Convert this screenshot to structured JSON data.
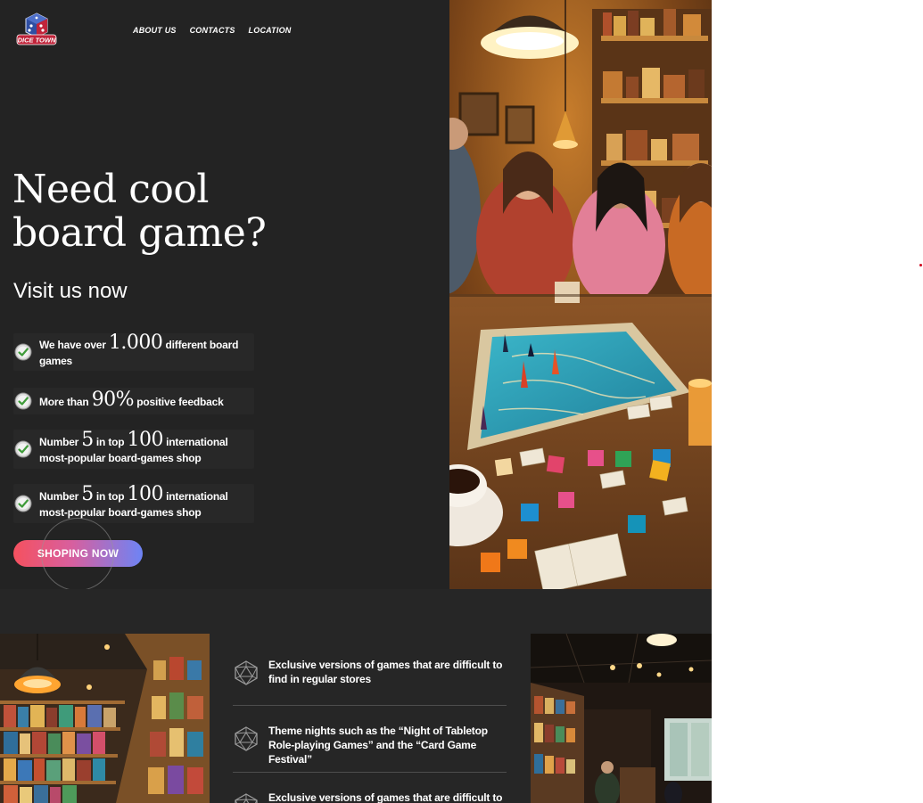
{
  "header": {
    "logo_text": "DICE TOWN",
    "nav": [
      "ABOUT US",
      "CONTACTS",
      "LOCATION"
    ]
  },
  "hero": {
    "title_line1": "Need cool",
    "title_line2": "board game?",
    "subtitle": "Visit us now",
    "features": [
      {
        "pre": "We have over",
        "num": "1.000",
        "post": "different board games"
      },
      {
        "pre": "More than",
        "num": "90%",
        "post": "positive feedback"
      },
      {
        "pre": "Number",
        "num": "5",
        "mid": "in top",
        "num2": "100",
        "post": "international most-popular board-games shop"
      },
      {
        "pre": "Number",
        "num": "5",
        "mid": "in top",
        "num2": "100",
        "post": "international most-popular board-games shop"
      }
    ],
    "cta_label": "SHOPING NOW",
    "check_icon": "checkmark-badge-icon"
  },
  "services": [
    {
      "text": "Exclusive versions of games that are difficult to find in regular stores"
    },
    {
      "text": "Theme nights such as the “Night of Tabletop Role-playing Games” and the “Card Game Festival”"
    },
    {
      "text": "Exclusive versions of games that are difficult to"
    }
  ],
  "colors": {
    "background_dark": "#232323",
    "cta_gradient_start": "#f5515f",
    "cta_gradient_end": "#6d84f5",
    "text": "#ffffff"
  }
}
